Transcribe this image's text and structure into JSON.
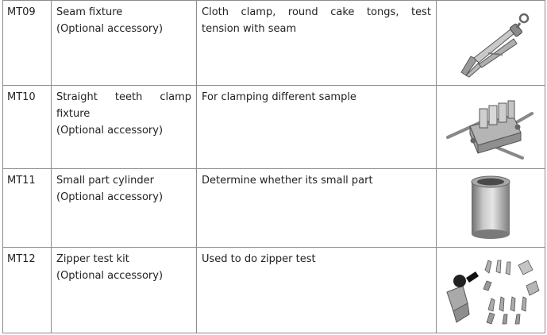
{
  "rows": [
    {
      "code": "MT09",
      "name": "Seam fixture",
      "note": "(Optional accessory)",
      "desc_line1": "Cloth clamp, round cake tongs, test",
      "desc_line2": "tension with seam",
      "image_icon": "locking-pliers-icon"
    },
    {
      "code": "MT10",
      "name_line1": "Straight teeth clamp",
      "name_line2": "fixture",
      "note": "(Optional accessory)",
      "desc": "For clamping different sample",
      "image_icon": "straight-teeth-clamp-icon"
    },
    {
      "code": "MT11",
      "name": "Small part cylinder",
      "note": "(Optional accessory)",
      "desc": "Determine whether its small part",
      "image_icon": "metal-cylinder-icon"
    },
    {
      "code": "MT12",
      "name": "Zipper test kit",
      "note": "(Optional accessory)",
      "desc": "Used to do zipper test",
      "image_icon": "zipper-test-kit-icon"
    }
  ]
}
